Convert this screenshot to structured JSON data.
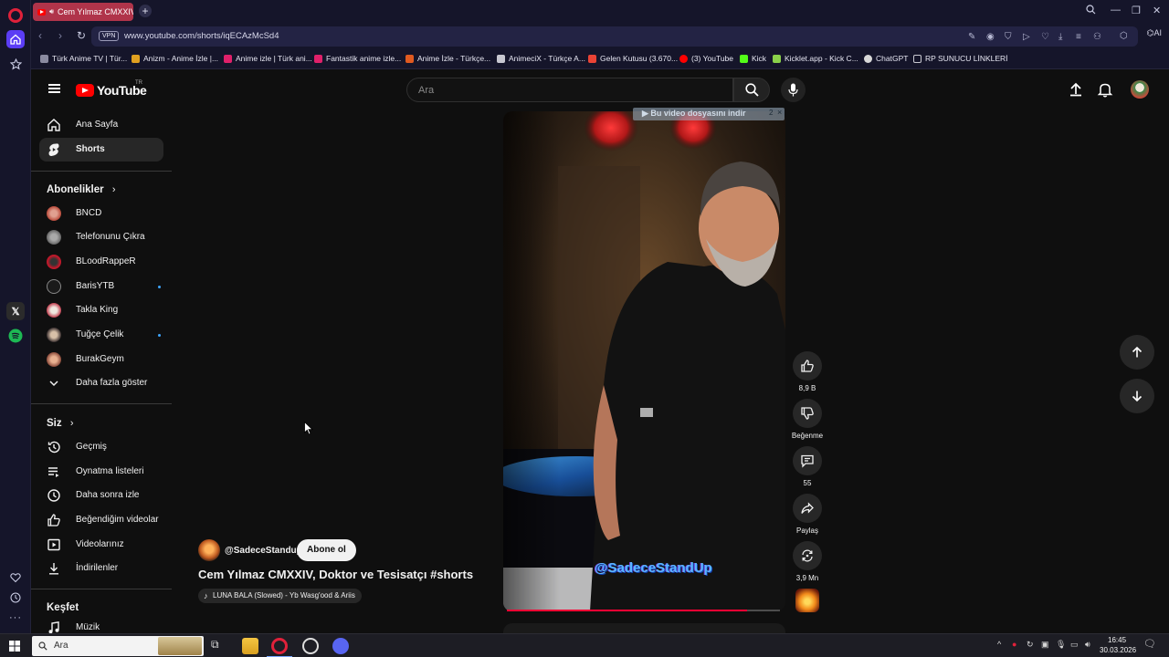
{
  "browser": {
    "tab_title": "Cem Yılmaz CMXXIV, D",
    "url": "www.youtube.com/shorts/iqECAzMcSd4",
    "vpn_label": "VPN",
    "ai_label": "AI",
    "bookmarks": [
      {
        "label": "Türk Anime TV | Tür...",
        "color": "#8a8aa0"
      },
      {
        "label": "Anizm - Anime İzle |...",
        "color": "#e0a020"
      },
      {
        "label": "Anime izle | Türk ani...",
        "color": "#e0206a"
      },
      {
        "label": "Fantastik anime izle...",
        "color": "#e0206a"
      },
      {
        "label": "Anime İzle - Türkçe...",
        "color": "#e05a20"
      },
      {
        "label": "AnimeciX - Türkçe A...",
        "color": "#c8c8d0"
      },
      {
        "label": "Gelen Kutusu (3.670...",
        "color": "#ea4335"
      },
      {
        "label": "(3) YouTube",
        "color": "#ff0000"
      },
      {
        "label": "Kick",
        "color": "#53fc18"
      },
      {
        "label": "Kicklet.app - Kick C...",
        "color": "#8ad04a"
      },
      {
        "label": "ChatGPT",
        "color": "#d8d8d8"
      },
      {
        "label": "RP SUNUCU LİNKLERİ",
        "color": "#c8c8d0"
      }
    ]
  },
  "youtube": {
    "logo_text": "YouTube",
    "logo_country": "TR",
    "search_placeholder": "Ara",
    "guide": {
      "home": "Ana Sayfa",
      "shorts": "Shorts",
      "subscriptions_header": "Abonelikler",
      "subscriptions": [
        {
          "name": "BNCD",
          "color": "#b84a3a",
          "dot": false
        },
        {
          "name": "Telefonunu Çıkra",
          "color": "#777777",
          "dot": false
        },
        {
          "name": "BLoodRappeR",
          "color": "#c0182a",
          "dot": false
        },
        {
          "name": "BarisYTB",
          "color": "#5a5a5a",
          "dot": true
        },
        {
          "name": "Takla King",
          "color": "#d8d0c8",
          "dot": false
        },
        {
          "name": "Tuğçe Çelik",
          "color": "#a08870",
          "dot": true
        },
        {
          "name": "BurakGeym",
          "color": "#c87a5a",
          "dot": false
        }
      ],
      "show_more": "Daha fazla göster",
      "you_header": "Siz",
      "you_items": [
        "Geçmiş",
        "Oynatma listeleri",
        "Daha sonra izle",
        "Beğendiğim videolar",
        "Videolarınız",
        "İndirilenler"
      ],
      "explore_header": "Keşfet",
      "explore_items": [
        "Müzik"
      ]
    },
    "short": {
      "channel": "@SadeceStandup",
      "subscribe_label": "Abone ol",
      "title": "Cem Yılmaz CMXXIV, Doktor ve Tesisatçı #shorts",
      "music": "LUNA BALA (Slowed) - Yb Wasg'ood & Ariis",
      "watermark": "@SadeceStandUp",
      "progress_fraction": 0.88
    },
    "actions": {
      "likes": "8,9 B",
      "dislike_label": "Beğenme",
      "comments": "55",
      "share_label": "Paylaş",
      "remix_count": "3,9 Mn"
    },
    "download_banner": {
      "text": "▶ Bu video dosyasını indir",
      "count": "2",
      "close": "×"
    }
  },
  "taskbar": {
    "search_placeholder": "Ara",
    "time": "16:45",
    "date": "30.03.2026"
  }
}
